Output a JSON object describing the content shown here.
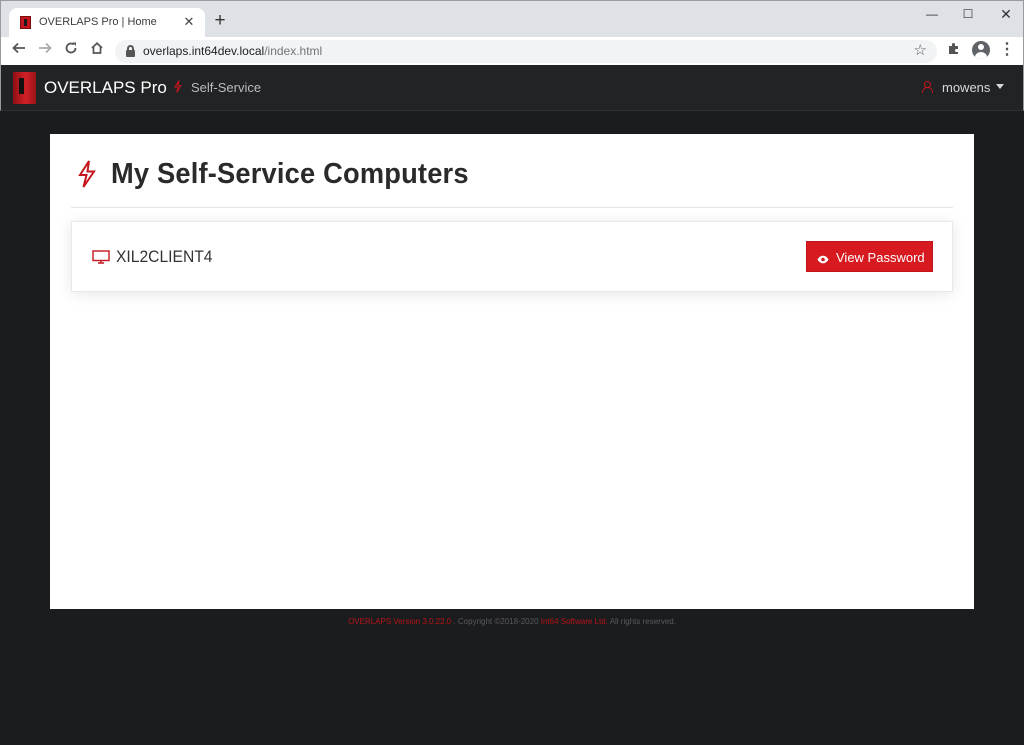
{
  "browser": {
    "tab_title": "OVERLAPS Pro | Home",
    "tab_close": "✕",
    "new_tab": "+",
    "url_host": "overlaps.int64dev.local",
    "url_path": "/index.html",
    "window_controls": {
      "minimize": "—",
      "maximize": "☐",
      "close": "✕"
    },
    "icons": [
      "back-arrow-icon",
      "forward-arrow-icon",
      "reload-icon",
      "home-icon",
      "lock-icon",
      "star-icon",
      "extensions-icon",
      "profile-icon",
      "menu-icon"
    ]
  },
  "navbar": {
    "brand": "OVERLAPS Pro",
    "link_self_service": "Self-Service",
    "username": "mowens"
  },
  "main": {
    "title": "My Self-Service Computers",
    "computers": [
      {
        "name": "XIL2CLIENT4",
        "button_label": "View Password"
      }
    ]
  },
  "footer": {
    "version": "OVERLAPS Version 3.0.22.0",
    "copyright_pre": " . Copyright ©2018-2020 ",
    "company": "Int64 Software Ltd.",
    "rights": " All rights reserved."
  },
  "colors": {
    "accent": "#d71920",
    "navbar_bg": "#222325",
    "page_bg": "#1b1c1e",
    "card_bg": "#ffffff"
  }
}
